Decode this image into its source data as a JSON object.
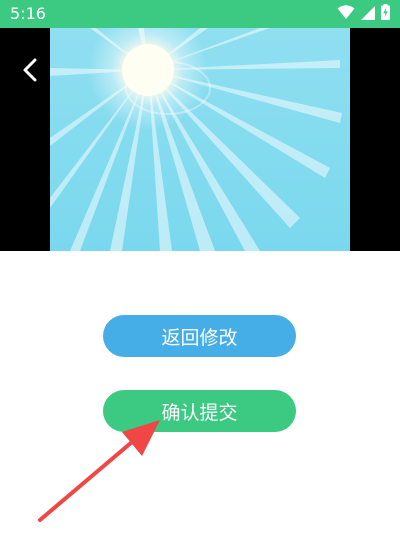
{
  "status_bar": {
    "time": "5:16",
    "icons": [
      "wifi-icon",
      "signal-icon",
      "battery-charging-icon"
    ]
  },
  "media": {
    "back_icon": "chevron-left-icon",
    "photo_description_icon": "sun-icon"
  },
  "actions": {
    "modify_label": "返回修改",
    "submit_label": "确认提交"
  },
  "colors": {
    "status_bar": "#3cc982",
    "sky": "#7fdcef",
    "modify_button": "#46aee6",
    "submit_button": "#3cc982",
    "arrow": "#f04646"
  }
}
